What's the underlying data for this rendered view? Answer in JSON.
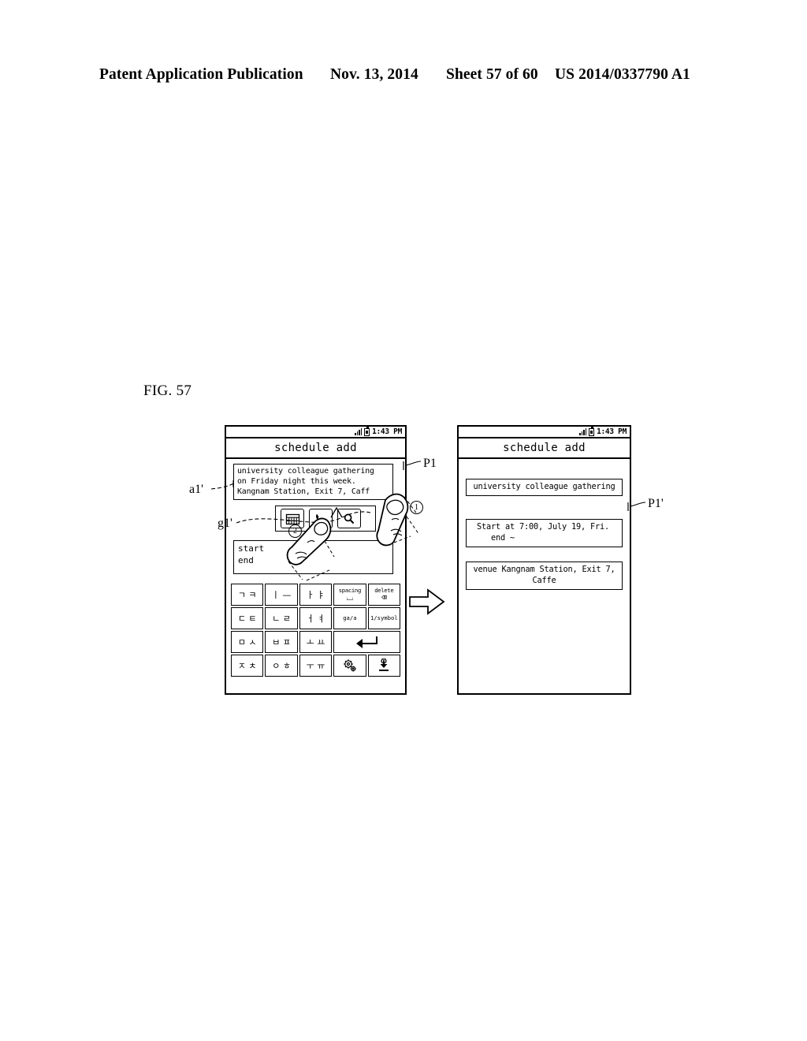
{
  "patent_header": {
    "publication": "Patent Application Publication",
    "date": "Nov. 13, 2014",
    "sheet": "Sheet 57 of 60",
    "number": "US 2014/0337790 A1"
  },
  "figure": {
    "label": "FIG. 57"
  },
  "annotations": {
    "a1": "a1'",
    "g1": "g1'",
    "p1": "P1",
    "p1_prime": "P1'",
    "step_one": "①",
    "step_two": "②",
    "arrow": "transition-arrow"
  },
  "phone_left": {
    "status_bar": {
      "signal_icon": "signal-bars-icon",
      "battery_icon": "battery-icon",
      "time": "1:43 PM"
    },
    "title": "schedule add",
    "memo": {
      "lines": [
        "university colleague gathering",
        "on Friday night this week.",
        "Kangnam Station, Exit 7, Caff"
      ]
    },
    "toolbar": {
      "buttons": [
        {
          "name": "calendar-icon",
          "label": "calendar"
        },
        {
          "name": "phone-icon",
          "label": "phone"
        },
        {
          "name": "search-icon",
          "label": "search"
        }
      ]
    },
    "schedule_fields": {
      "start_label": "start",
      "end_label": "end"
    },
    "keypad": {
      "rows": [
        [
          {
            "name": "key-giyeok-kieuk",
            "label": "ㄱ ㅋ",
            "type": "glyph"
          },
          {
            "name": "key-i-eu",
            "label": "ㅣ —",
            "type": "glyph"
          },
          {
            "name": "key-a-ya",
            "label": "ㅏ ㅑ",
            "type": "glyph"
          },
          {
            "name": "key-spacing",
            "label": "spacing",
            "sub": "⌴",
            "type": "caption"
          },
          {
            "name": "key-delete",
            "label": "delete",
            "sub": "⌫",
            "type": "caption"
          }
        ],
        [
          {
            "name": "key-digeut-tieut",
            "label": "ㄷ ㅌ",
            "type": "glyph"
          },
          {
            "name": "key-nieun-rieul",
            "label": "ㄴ ㄹ",
            "type": "glyph"
          },
          {
            "name": "key-eo-yeo",
            "label": "ㅓ ㅕ",
            "type": "glyph"
          },
          {
            "name": "key-ga-a",
            "label": "ga/a",
            "type": "caption"
          },
          {
            "name": "key-number-symbol",
            "label": "1/symbol",
            "type": "caption"
          }
        ],
        [
          {
            "name": "key-mieum-siot",
            "label": "ㅁ ㅅ",
            "type": "glyph"
          },
          {
            "name": "key-bieup-pieup",
            "label": "ㅂ ㅍ",
            "type": "glyph"
          },
          {
            "name": "key-o-yo",
            "label": "ㅗ ㅛ",
            "type": "glyph"
          },
          {
            "name": "key-enter",
            "label": "↵",
            "type": "enter",
            "wide": true
          }
        ],
        [
          {
            "name": "key-jieut-chieut",
            "label": "ㅈ ㅊ",
            "type": "glyph"
          },
          {
            "name": "key-ieung-hieut",
            "label": "ㅇ ㅎ",
            "type": "glyph"
          },
          {
            "name": "key-u-yu",
            "label": "ㅜ ㅠ",
            "type": "glyph"
          },
          {
            "name": "key-settings",
            "label": "settings-gear-icon",
            "type": "icon"
          },
          {
            "name": "key-hide-keyboard",
            "label": "hide-keyboard-icon",
            "type": "icon"
          }
        ]
      ]
    }
  },
  "phone_right": {
    "status_bar": {
      "signal_icon": "signal-bars-icon",
      "battery_icon": "battery-icon",
      "time": "1:43 PM"
    },
    "title": "schedule add",
    "fields": {
      "title_value": "university colleague gathering",
      "time_line1": "Start at 7:00, July 19, Fri.",
      "time_line2": "end          ~",
      "venue_line1": "venue Kangnam Station, Exit 7,",
      "venue_line2": "Caffe"
    }
  }
}
